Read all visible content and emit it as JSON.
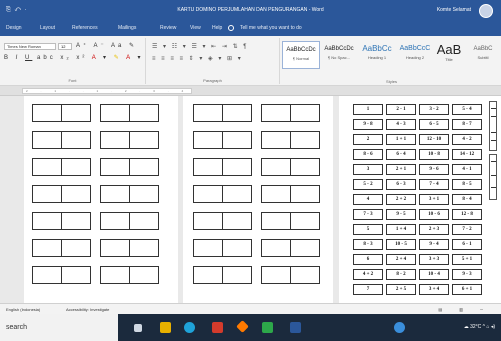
{
  "window": {
    "quick_access": "⎘ ↶ ·",
    "title": "KARTU DOMINO PERJUMLAHAN DAN PENGURANGAN - Word",
    "user": "Komte Selamat"
  },
  "ribbon_tabs": [
    "Design",
    "Layout",
    "References",
    "Mailings",
    "Review",
    "View",
    "Help",
    "Tell me what you want to do"
  ],
  "ribbon": {
    "font_name": "Times New Roman",
    "font_size": "12",
    "font_group_label": "Font",
    "paragraph_group_label": "Paragraph",
    "styles_group_label": "Styles",
    "styles": [
      {
        "sample": "AaBbCcDc",
        "name": "¶ Normal"
      },
      {
        "sample": "AaBbCcDc",
        "name": "¶ No Spac..."
      },
      {
        "sample": "AaBbCc",
        "name": "Heading 1"
      },
      {
        "sample": "AaBbCcC",
        "name": "Heading 2"
      },
      {
        "sample": "AaB",
        "name": "Title"
      },
      {
        "sample": "AaBbC",
        "name": "Subtitl"
      }
    ]
  },
  "ruler_text": "2 · 1 · · 1 · 2 · 3 · 4 · 5 · 6 · 7 · 8 · 9 · 10 · 11",
  "domino_cards": [
    [
      "1",
      "2 - 1",
      "3 - 2",
      "5 - 4"
    ],
    [
      "9 - 8",
      "4 - 3",
      "6 - 5",
      "8 - 7"
    ],
    [
      "2",
      "1 + 1",
      "12 - 10",
      "4 - 2"
    ],
    [
      "8 - 6",
      "6 - 4",
      "10 - 8",
      "14 - 12"
    ],
    [
      "3",
      "2 + 1",
      "9 - 6",
      "4 - 1"
    ],
    [
      "5 - 2",
      "6 - 3",
      "7 - 4",
      "8 - 5"
    ],
    [
      "4",
      "2 + 2",
      "3 + 1",
      "8 - 4"
    ],
    [
      "7 - 3",
      "9 - 5",
      "10 - 6",
      "12 - 8"
    ],
    [
      "5",
      "1 + 4",
      "2 + 3",
      "7 - 2"
    ],
    [
      "8 - 3",
      "10 - 5",
      "9 - 4",
      "6 - 1"
    ],
    [
      "6",
      "2 + 4",
      "3 + 3",
      "5 + 1"
    ],
    [
      "4 + 2",
      "8 - 2",
      "10 - 4",
      "9 - 3"
    ],
    [
      "7",
      "2 + 5",
      "3 + 4",
      "6 + 1"
    ]
  ],
  "status_bar": {
    "language": "English (Indonesia)",
    "accessibility": "Accessibility: Investigate",
    "view_icons": "▤ ▥ ─"
  },
  "taskbar": {
    "search_placeholder": "search",
    "weather": "32°C",
    "tray": "^ ⌂ ◂)"
  }
}
